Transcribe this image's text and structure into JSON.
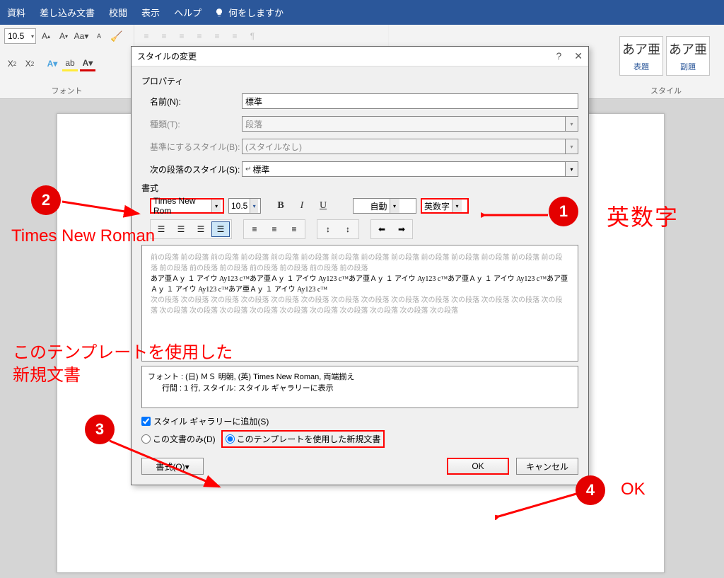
{
  "ribbon": {
    "tabs": [
      "資料",
      "差し込み文書",
      "校閲",
      "表示",
      "ヘルプ"
    ],
    "tell_me": "何をしますか",
    "font_size": "10.5",
    "group_font": "フォント",
    "group_style": "スタイル"
  },
  "style_cards": [
    {
      "sample": "あア亜",
      "label": "表題"
    },
    {
      "sample": "あア亜",
      "label": "副題"
    }
  ],
  "dialog": {
    "title": "スタイルの変更",
    "section_props": "プロパティ",
    "labels": {
      "name": "名前(N):",
      "kind": "種類(T):",
      "based_on": "基準にするスタイル(B):",
      "next": "次の段落のスタイル(S):"
    },
    "values": {
      "name": "標準",
      "kind": "段落",
      "based_on": "(スタイルなし)",
      "next": "標準"
    },
    "section_format": "書式",
    "font_name": "Times New Rom",
    "font_size": "10.5",
    "font_color": "自動",
    "script": "英数字",
    "preview_gray": "前の段落 前の段落 前の段落 前の段落 前の段落 前の段落 前の段落 前の段落 前の段落 前の段落 前の段落 前の段落 前の段落 前の段落 前の段落 前の段落 前の段落 前の段落 前の段落 前の段落 前の段落",
    "preview_sample": "あア亜Ａｙ １ アイウ Ay123 c™あア亜Ａｙ １ アイウ Ay123 c™あア亜Ａｙ １ アイウ Ay123 c™あア亜Ａｙ １ アイウ Ay123 c™あア亜Ａｙ １ アイウ Ay123 c™あア亜Ａｙ １ アイウ Ay123 c™",
    "preview_gray2": "次の段落 次の段落 次の段落 次の段落 次の段落 次の段落 次の段落 次の段落 次の段落 次の段落 次の段落 次の段落 次の段落 次の段落 次の段落 次の段落 次の段落 次の段落 次の段落 次の段落 次の段落 次の段落 次の段落 次の段落",
    "desc_line1": "フォント : (日) ＭＳ 明朝, (英) Times New Roman, 両端揃え",
    "desc_line2": "行間 : 1 行, スタイル: スタイル ギャラリーに表示",
    "chk_gallery": "スタイル ギャラリーに追加(S)",
    "rad_doc_only": "この文書のみ(D)",
    "rad_template": "このテンプレートを使用した新規文書",
    "btn_format": "書式(O)▾",
    "btn_ok": "OK",
    "btn_cancel": "キャンセル"
  },
  "annotations": {
    "n1": "1",
    "n2": "2",
    "n3": "3",
    "n4": "4",
    "eng_num": "英数字",
    "tnr": "Times New Roman",
    "template_line1": "このテンプレートを使用した",
    "template_line2": "新規文書",
    "ok": "OK"
  }
}
